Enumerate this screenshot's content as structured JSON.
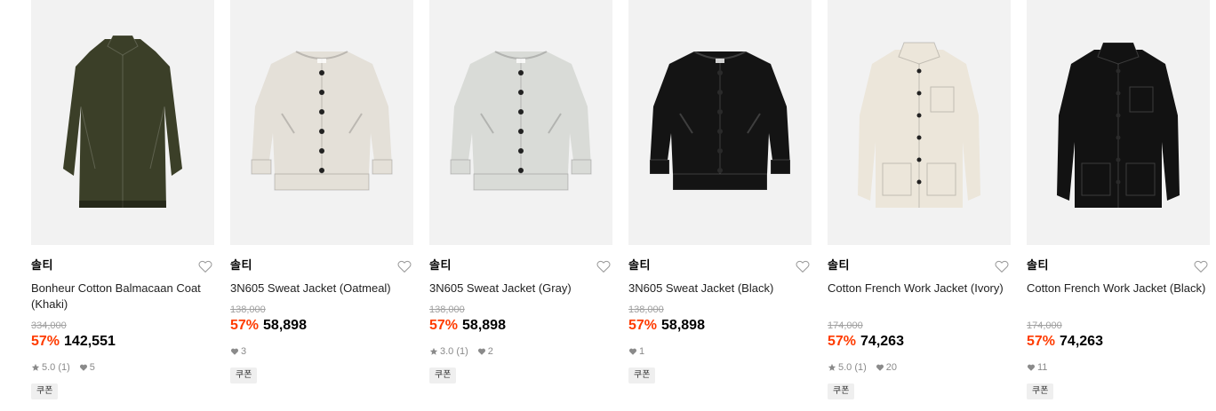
{
  "products": [
    {
      "brand": "솔티",
      "name": "Bonheur Cotton Balmacaan Coat (Khaki)",
      "original_price": "334,000",
      "discount": "57%",
      "price": "142,551",
      "rating": "5.0 (1)",
      "likes": "5",
      "coupon": "쿠폰",
      "garment": "coat",
      "color": "#3b3f28",
      "image_alt": "khaki coat"
    },
    {
      "brand": "솔티",
      "name": "3N605 Sweat Jacket (Oatmeal)",
      "original_price": "138,000",
      "discount": "57%",
      "price": "58,898",
      "rating": "",
      "likes": "3",
      "coupon": "쿠폰",
      "garment": "jacket",
      "color": "#e4e0d8",
      "image_alt": "oatmeal jacket"
    },
    {
      "brand": "솔티",
      "name": "3N605 Sweat Jacket (Gray)",
      "original_price": "138,000",
      "discount": "57%",
      "price": "58,898",
      "rating": "3.0 (1)",
      "likes": "2",
      "coupon": "쿠폰",
      "garment": "jacket",
      "color": "#d9dbd7",
      "image_alt": "gray jacket"
    },
    {
      "brand": "솔티",
      "name": "3N605 Sweat Jacket (Black)",
      "original_price": "138,000",
      "discount": "57%",
      "price": "58,898",
      "rating": "",
      "likes": "1",
      "coupon": "쿠폰",
      "garment": "jacket",
      "color": "#141414",
      "image_alt": "black jacket"
    },
    {
      "brand": "솔티",
      "name": "Cotton French Work Jacket (Ivory)",
      "original_price": "174,000",
      "discount": "57%",
      "price": "74,263",
      "rating": "5.0 (1)",
      "likes": "20",
      "coupon": "쿠폰",
      "garment": "work",
      "color": "#ece6da",
      "image_alt": "ivory work jacket"
    },
    {
      "brand": "솔티",
      "name": "Cotton French Work Jacket (Black)",
      "original_price": "174,000",
      "discount": "57%",
      "price": "74,263",
      "rating": "",
      "likes": "11",
      "coupon": "쿠폰",
      "garment": "work",
      "color": "#121212",
      "image_alt": "black work jacket"
    }
  ],
  "icons": {
    "heart": "heart-outline-icon",
    "star": "star-icon",
    "likes": "heart-filled-icon"
  },
  "colors": {
    "discount": "#ff3b00",
    "muted": "#a0a0a0",
    "thumb_bg": "#f2f2f2",
    "coupon_bg": "#efefef"
  }
}
